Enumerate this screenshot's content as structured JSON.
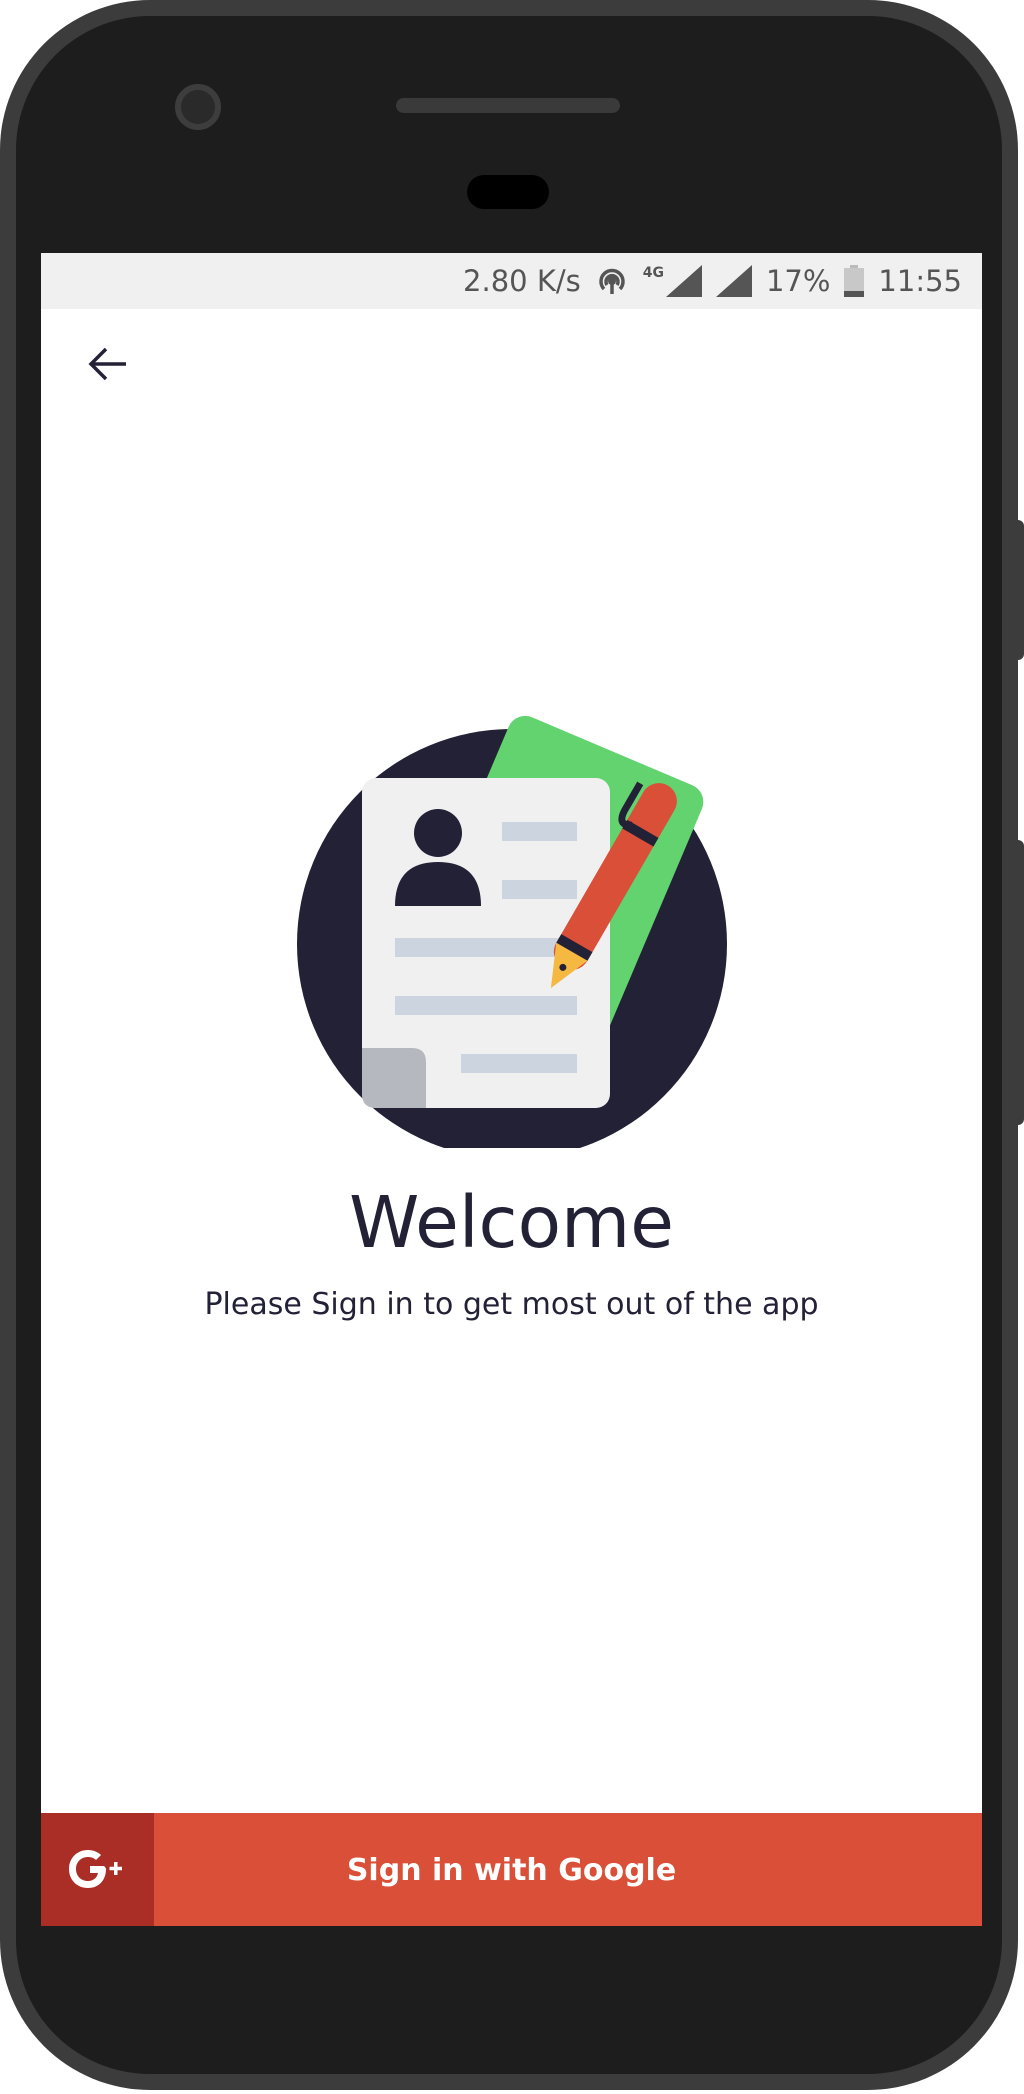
{
  "status_bar": {
    "speed": "2.80 K/s",
    "network": "4G",
    "battery": "17%",
    "time": "11:55"
  },
  "header": {
    "back_icon": "arrow-left-icon"
  },
  "main": {
    "title": "Welcome",
    "subtitle": "Please Sign in to get most out of the app"
  },
  "signin": {
    "label": "Sign in with Google",
    "icon": "google-plus-icon"
  },
  "colors": {
    "accent": "#d94f38",
    "accent_dark": "#ab2e26",
    "text": "#232136",
    "green": "#62d36f"
  }
}
